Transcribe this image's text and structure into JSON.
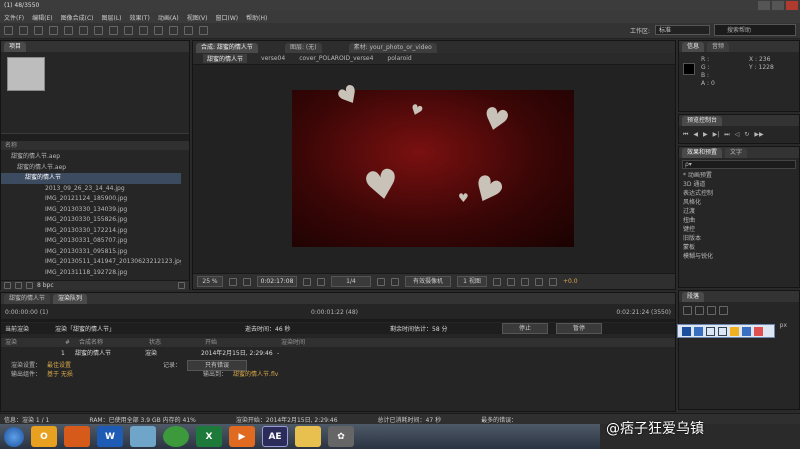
{
  "window": {
    "title": "(1) 48/3550"
  },
  "menubar": {
    "items": [
      "文件(F)",
      "编辑(E)",
      "图像合成(C)",
      "图层(L)",
      "效果(T)",
      "动画(A)",
      "视图(V)",
      "窗口(W)",
      "帮助(H)"
    ]
  },
  "toolbar": {
    "workspace_label": "工作区:",
    "workspace_value": "标准",
    "search_placeholder": "搜索帮助"
  },
  "project": {
    "tab": "项目",
    "column_name": "名称",
    "items": [
      "甜蜜的情人节.aep",
      "甜蜜的情人节.aep",
      "甜蜜的情人节",
      "2013_09_26_23_14_44.jpg",
      "IMG_20121124_185900.jpg",
      "IMG_20130330_134039.jpg",
      "IMG_20130330_155826.jpg",
      "IMG_20130330_172214.jpg",
      "IMG_20130331_085707.jpg",
      "IMG_20130331_095815.jpg",
      "IMG_20130511_141947_20130623212123.jpg",
      "IMG_20131118_192728.jpg"
    ],
    "bpc": "8 bpc"
  },
  "comp": {
    "tabs": [
      "合成: 甜蜜的情人节",
      "图层: (无)",
      "素材: your_photo_or_video"
    ],
    "breadcrumbs": [
      "甜蜜的情人节",
      "verse04",
      "cover_POLAROID_verse4",
      "polaroid"
    ],
    "zoom": "25 %",
    "timecode": "0:02:17:08",
    "resolution": "1/4",
    "camera": "有效摄像机",
    "views": "1 视图",
    "offset": "+0.0"
  },
  "info_panel": {
    "tabs": [
      "信息",
      "音频"
    ],
    "r": "R :",
    "g": "G :",
    "b": "B :",
    "a": "A : 0",
    "x": "X : 236",
    "y": "Y : 1228"
  },
  "preview_panel": {
    "tab": "预览控制台"
  },
  "effects_panel": {
    "tabs": [
      "效果和预置",
      "文字"
    ],
    "search": "ρ▾",
    "items": [
      "* 动画预置",
      "3D 通道",
      "表达式控制",
      "风格化",
      "过渡",
      "扭曲",
      "键控",
      "旧版本",
      "蒙板",
      "模糊与锐化"
    ]
  },
  "paragraph_panel": {
    "tab": "段落",
    "px": "px"
  },
  "timeline": {
    "tabs": [
      "甜蜜的情人节",
      "渲染队列"
    ],
    "start_time": "0:00:00:00 (1)",
    "elapsed": "0:00:01:22 (48)",
    "end_time": "0:02:21:24 (3550)",
    "rendering_label": "当前渲染",
    "rendering_name": "渲染「甜蜜的情人节」",
    "elapsed_label": "逝去时间：46 秒",
    "remaining_label": "剩余时间估计：58 分",
    "stop": "停止",
    "pause": "暂停",
    "columns": [
      "渲染",
      "#",
      "合成名称",
      "状态",
      "开始",
      "渲染时间"
    ],
    "item": {
      "num": "1",
      "name": "甜蜜的情人节",
      "status": "渲染",
      "start": "2014年2月15日, 2:29:46",
      "time": "-"
    },
    "render_settings_label": "渲染设置：",
    "render_settings_value": "最佳设置",
    "log_label": "记录：",
    "log_value": "只有错误",
    "output_label": "输出组件：",
    "output_value": "基于 无损",
    "output_to_label": "输出到：",
    "output_to_value": "甜蜜的情人节.flv"
  },
  "status": {
    "info": "信息：渲染 1 / 1",
    "ram": "RAM：已使用全部 3.9 GB 内存的 41%",
    "render_start": "渲染开始：2014年2月15日, 2:29:46",
    "total_elapsed": "总计已消耗时间：47 秒",
    "last_error": "最多的错误："
  },
  "watermark": "@痞子狂爱乌镇",
  "taskbar": {
    "icons": [
      "start-orb-icon",
      "outlook-icon",
      "firefox-icon",
      "word-icon",
      "file-icon",
      "chrome-icon",
      "excel-icon",
      "media-icon",
      "after-effects-icon",
      "folder-icon",
      "settings-icon"
    ],
    "ae_label": "AE"
  }
}
